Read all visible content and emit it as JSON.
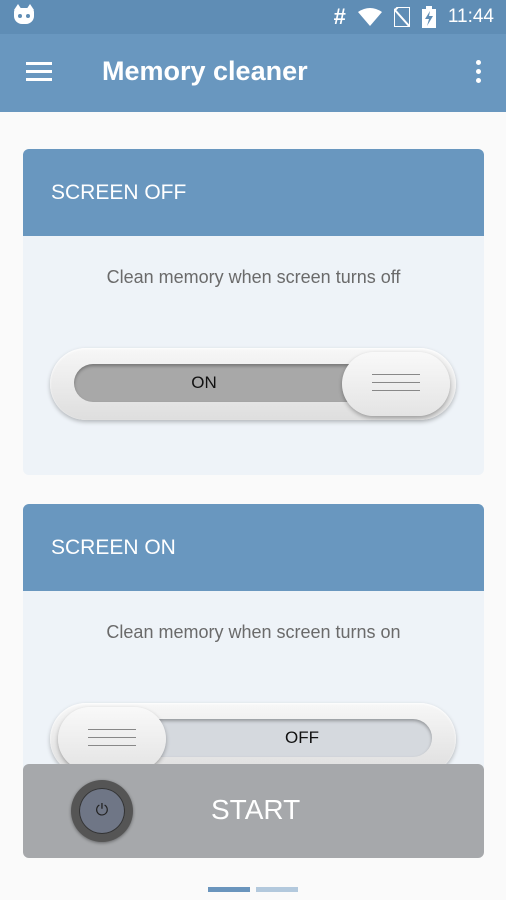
{
  "status_bar": {
    "hash": "#",
    "time": "11:44"
  },
  "app_bar": {
    "title": "Memory cleaner"
  },
  "cards": [
    {
      "title": "SCREEN OFF",
      "description": "Clean memory when screen turns off",
      "toggle_label": "ON"
    },
    {
      "title": "SCREEN ON",
      "description": "Clean memory when screen turns on",
      "toggle_label": "OFF"
    }
  ],
  "start": {
    "label": "START",
    "power_glyph": "⏻"
  },
  "colors": {
    "primary": "#6997bf",
    "status_bar": "#5f8db5",
    "card_bg": "#eef3f8",
    "start_bg": "#a6a8ab"
  }
}
